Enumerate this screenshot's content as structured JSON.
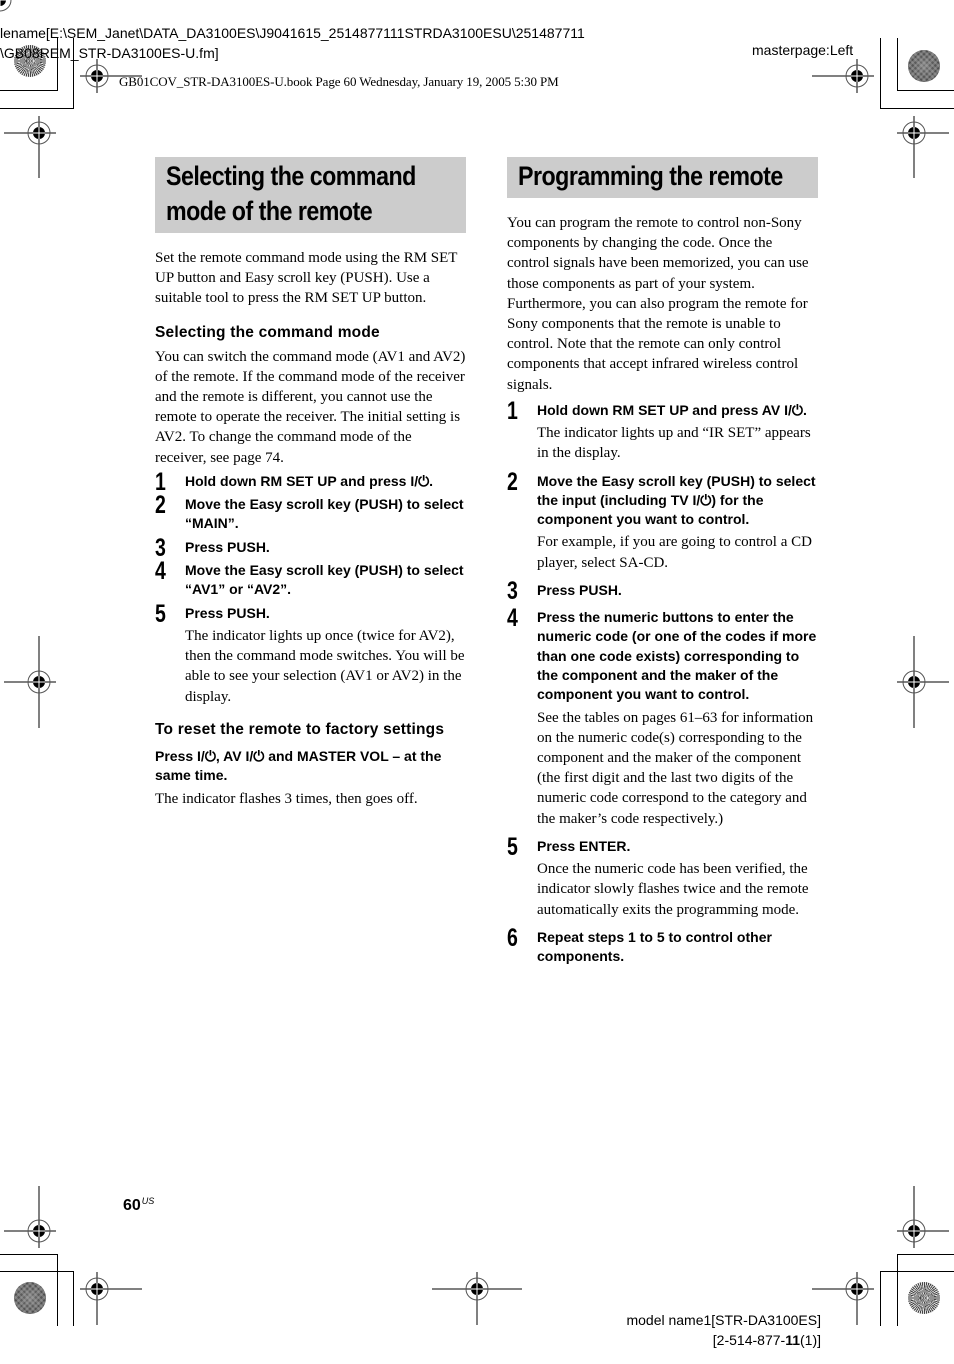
{
  "header": {
    "filename_line1": "lename[E:\\SEM_Janet\\DATA_DA3100ES\\J9041615_2514877111STRDA3100ESU\\251487711",
    "filename_line2": "\\GB08REM_STR-DA3100ES-U.fm]",
    "masterpage": "masterpage:Left",
    "book_info": "GB01COV_STR-DA3100ES-U.book  Page 60  Wednesday, January 19, 2005  5:30 PM"
  },
  "left_section": {
    "title_line1": "Selecting the command",
    "title_line2": "mode of the remote",
    "intro": "Set the remote command mode using the RM SET UP button and Easy scroll key (PUSH). Use a suitable tool to press the RM SET UP button.",
    "subsection1": {
      "heading": "Selecting the command mode",
      "body": "You can switch the command mode (AV1 and AV2) of the remote. If the command mode of the receiver and the remote is different, you cannot use the remote to operate the receiver. The initial setting is AV2. To change the command mode of the receiver, see page 74.",
      "steps": [
        {
          "num": "1",
          "title": "Hold down RM SET UP and press I/⏻.",
          "desc": ""
        },
        {
          "num": "2",
          "title": "Move the Easy scroll key (PUSH) to select “MAIN”.",
          "desc": ""
        },
        {
          "num": "3",
          "title": "Press PUSH.",
          "desc": ""
        },
        {
          "num": "4",
          "title": "Move the Easy scroll key (PUSH) to select “AV1” or “AV2”.",
          "desc": ""
        },
        {
          "num": "5",
          "title": "Press PUSH.",
          "desc": "The indicator lights up once (twice for AV2), then the command mode switches. You will be able to see your selection (AV1 or  AV2) in the display."
        }
      ]
    },
    "subsection2": {
      "heading": "To reset the remote to factory settings",
      "instruction": "Press I/⏻, AV I/⏻ and MASTER VOL – at the same time.",
      "body": "The indicator flashes 3 times, then goes off."
    }
  },
  "right_section": {
    "title": "Programming the remote",
    "intro1": "You can program the remote to control non-Sony components by changing the code. Once the control signals have been memorized, you can use those components as part of your system.",
    "intro2": "Furthermore, you can also program the remote for Sony components that the remote is unable to control. Note that the remote can only control components that accept infrared wireless control signals.",
    "steps": [
      {
        "num": "1",
        "title": "Hold down RM SET UP and press AV I/⏻.",
        "desc": "The indicator lights up and “IR SET” appears in the display."
      },
      {
        "num": "2",
        "title": "Move the Easy scroll key (PUSH) to select the input (including TV I/⏻) for the component you want to control.",
        "desc": "For example, if you are going to control a CD player, select SA-CD."
      },
      {
        "num": "3",
        "title": "Press PUSH.",
        "desc": ""
      },
      {
        "num": "4",
        "title": "Press the numeric buttons to enter the numeric code (or one of the codes if more than one code exists) corresponding to the component and the maker of the component you want to control.",
        "desc": "See the tables on pages 61–63 for information on the numeric code(s) corresponding to the component and the maker of the component (the first digit and the last two digits of the numeric code correspond to the category and the maker’s code respectively.)"
      },
      {
        "num": "5",
        "title": "Press ENTER.",
        "desc": "Once the numeric code has been verified, the indicator slowly flashes twice and the remote automatically exits the programming mode."
      },
      {
        "num": "6",
        "title": "Repeat steps 1 to 5 to control other components.",
        "desc": ""
      }
    ]
  },
  "footer": {
    "page_number": "60",
    "page_suffix": "US",
    "model_name": "model name1[STR-DA3100ES]",
    "part_number_prefix": "[2-514-877-",
    "part_number_bold": "11",
    "part_number_suffix": "(1)]"
  },
  "colors": {
    "heading_box": "#cccccc",
    "text": "#000000"
  }
}
